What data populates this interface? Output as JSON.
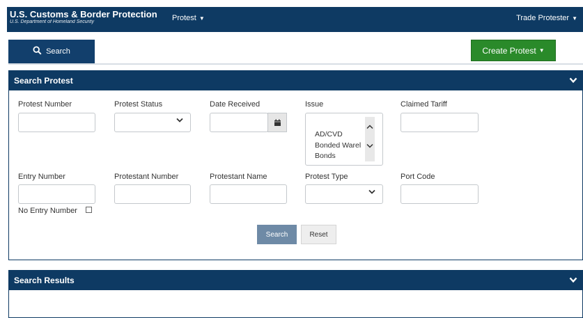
{
  "header": {
    "title": "U.S. Customs & Border Protection",
    "subtitle": "U.S. Department of Homeland Security",
    "nav_protest": "Protest",
    "user_menu": "Trade Protester"
  },
  "tabs": {
    "search_label": "Search"
  },
  "create_button": "Create Protest",
  "search_panel": {
    "title": "Search Protest",
    "fields": {
      "protest_number": "Protest Number",
      "protest_status": "Protest Status",
      "date_received": "Date Received",
      "issue": "Issue",
      "claimed_tariff": "Claimed Tariff",
      "entry_number": "Entry Number",
      "protestant_number": "Protestant Number",
      "protestant_name": "Protestant Name",
      "protest_type": "Protest Type",
      "port_code": "Port Code",
      "no_entry_number": "No Entry Number"
    },
    "issue_options": [
      "AD/CVD",
      "Bonded Warel",
      "Bonds"
    ],
    "search_button": "Search",
    "reset_button": "Reset"
  },
  "results_panel": {
    "title": "Search Results"
  },
  "icons": {
    "search": "search-icon",
    "calendar": "calendar-icon",
    "chevron": "chevron-down-icon"
  },
  "colors": {
    "navy": "#0e3a63",
    "green": "#2a8a2a",
    "search_button": "#6e8aa6"
  }
}
